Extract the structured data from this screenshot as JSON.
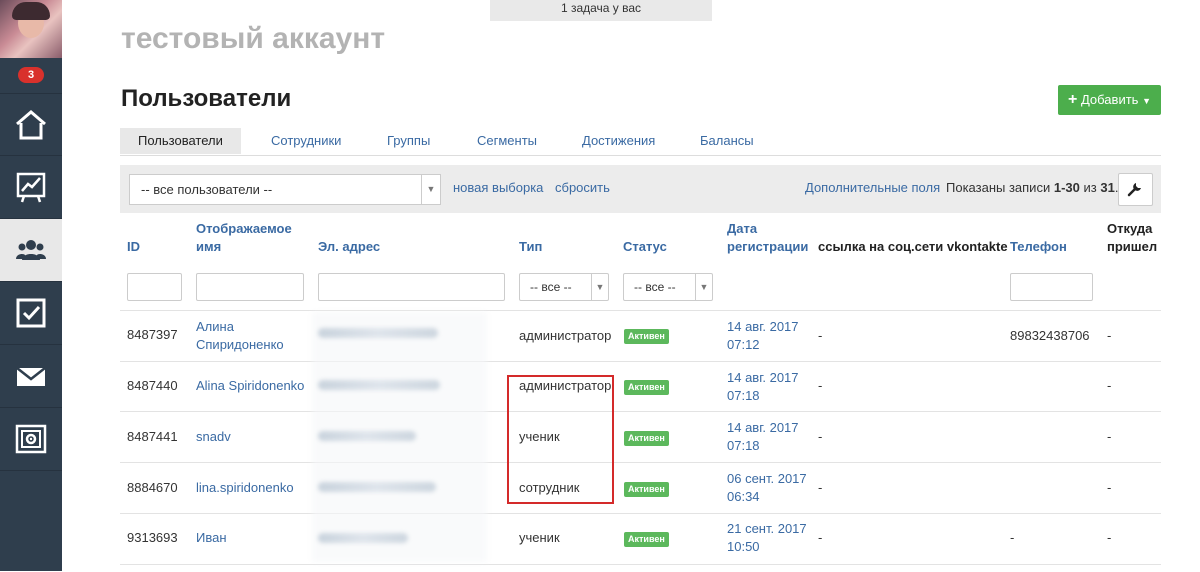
{
  "banner": {
    "text": "1 задача у вас"
  },
  "sidebar": {
    "notification_count": "3",
    "items": [
      {
        "name": "home-icon"
      },
      {
        "name": "chart-icon"
      },
      {
        "name": "users-icon"
      },
      {
        "name": "checkbox-icon"
      },
      {
        "name": "mail-icon"
      },
      {
        "name": "safe-icon"
      }
    ]
  },
  "header": {
    "account": "тестовый аккаунт",
    "title": "Пользователи",
    "add_button": "Добавить"
  },
  "tabs": [
    {
      "label": "Пользователи",
      "active": true
    },
    {
      "label": "Сотрудники"
    },
    {
      "label": "Группы"
    },
    {
      "label": "Сегменты"
    },
    {
      "label": "Достижения"
    },
    {
      "label": "Балансы"
    }
  ],
  "filter": {
    "selection": "-- все пользователи --",
    "new_selection": "новая выборка",
    "reset": "сбросить",
    "extra_fields": "Дополнительные поля",
    "shown_prefix": "Показаны записи",
    "shown_range": "1-30",
    "shown_of": "из",
    "shown_total": "31",
    "shown_dot": "."
  },
  "table": {
    "columns": {
      "id": "ID",
      "name_1": "Отображаемое",
      "name_2": "имя",
      "email": "Эл. адрес",
      "type": "Тип",
      "status": "Статус",
      "date_1": "Дата",
      "date_2": "регистрации",
      "vk": "ссылка на соц.сети vkontakte",
      "phone": "Телефон",
      "from_1": "Откуда",
      "from_2": "пришел"
    },
    "filters": {
      "type_all": "-- все --",
      "status_all": "-- все --"
    },
    "rows": [
      {
        "id": "8487397",
        "name_1": "Алина",
        "name_2": "Спиридоненко",
        "type": "администратор",
        "status": "Активен",
        "date_1": "14 авг. 2017",
        "date_2": "07:12",
        "vk": "-",
        "phone": "89832438706",
        "from": "-"
      },
      {
        "id": "8487440",
        "name_1": "Alina Spiridonenko",
        "name_2": "",
        "type": "администратор",
        "status": "Активен",
        "date_1": "14 авг. 2017",
        "date_2": "07:18",
        "vk": "-",
        "phone": "",
        "from": "-"
      },
      {
        "id": "8487441",
        "name_1": "snadv",
        "name_2": "",
        "type": "ученик",
        "status": "Активен",
        "date_1": "14 авг. 2017",
        "date_2": "07:18",
        "vk": "-",
        "phone": "",
        "from": "-"
      },
      {
        "id": "8884670",
        "name_1": "lina.spiridonenko",
        "name_2": "",
        "type": "сотрудник",
        "status": "Активен",
        "date_1": "06 сент. 2017",
        "date_2": "06:34",
        "vk": "-",
        "phone": "",
        "from": "-"
      },
      {
        "id": "9313693",
        "name_1": "Иван",
        "name_2": "",
        "type": "ученик",
        "status": "Активен",
        "date_1": "21 сент. 2017",
        "date_2": "10:50",
        "vk": "-",
        "phone": "-",
        "from": "-"
      }
    ]
  },
  "colors": {
    "sidebar": "#2f3e4d",
    "link": "#3a6aa3",
    "success": "#5cb85c",
    "danger": "#d9312c",
    "highlight": "#d42a2a"
  }
}
